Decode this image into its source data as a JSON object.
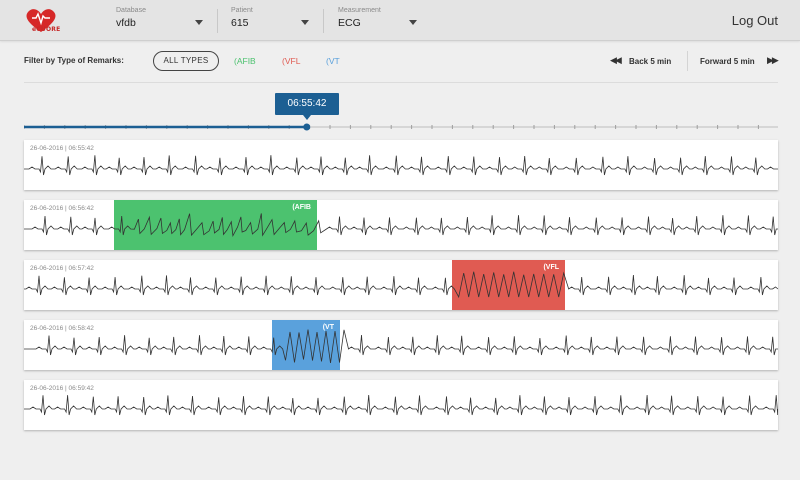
{
  "app": {
    "logo_text": "eCUORE",
    "logout": "Log Out"
  },
  "header": {
    "database": {
      "label": "Database",
      "value": "vfdb"
    },
    "patient": {
      "label": "Patient",
      "value": "615"
    },
    "measurement": {
      "label": "Measurement",
      "value": "ECG"
    }
  },
  "filter": {
    "label": "Filter by Type of Remarks:",
    "all": "ALL TYPES",
    "afib": "(AFIB",
    "vfl": "(VFL",
    "vt": "(VT"
  },
  "nav": {
    "back": "Back 5 min",
    "forward": "Forward 5 min"
  },
  "timeline": {
    "current_time": "06:55:42",
    "position_fraction": 0.375
  },
  "colors": {
    "afib": "#4cc26f",
    "vfl": "#e05b52",
    "vt": "#5aa1dc",
    "timeline": "#1c5f93"
  },
  "rows": [
    {
      "timestamp": "26-06-2016 | 06:55:42"
    },
    {
      "timestamp": "26-06-2016 | 06:56:42",
      "remark": "(AFIB"
    },
    {
      "timestamp": "26-06-2016 | 06:57:42",
      "remark": "(VFL"
    },
    {
      "timestamp": "26-06-2016 | 06:58:42",
      "remark": "(VT"
    },
    {
      "timestamp": "26-06-2016 | 06:59:42"
    }
  ]
}
